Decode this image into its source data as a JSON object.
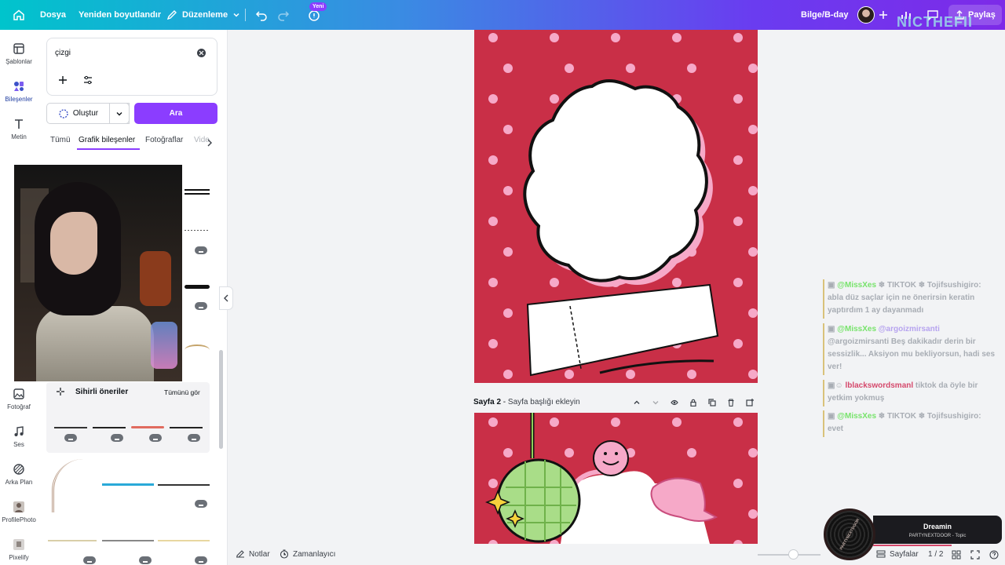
{
  "topbar": {
    "file": "Dosya",
    "resize": "Yeniden boyutlandır",
    "edit": "Düzenleme",
    "new_badge": "Yeni",
    "doc_title": "Bilge/B-day",
    "share": "Paylaş",
    "watermark": "NICTHEFII"
  },
  "rail": [
    {
      "label": "Şablonlar",
      "icon": "templates-icon"
    },
    {
      "label": "Bileşenler",
      "icon": "elements-icon"
    },
    {
      "label": "Metin",
      "icon": "text-icon"
    },
    {
      "label": "Fotoğraf",
      "icon": "photo-icon"
    },
    {
      "label": "Ses",
      "icon": "audio-icon"
    },
    {
      "label": "Arka Plan",
      "icon": "background-icon"
    },
    {
      "label": "ProfilePhoto",
      "icon": "profile-photo-icon"
    },
    {
      "label": "Pixelify",
      "icon": "pixelify-icon"
    }
  ],
  "search": {
    "value": "çizgi",
    "create_label": "Oluştur",
    "search_label": "Ara"
  },
  "tabs": [
    "Tümü",
    "Grafik bileşenler",
    "Fotoğraflar",
    "Vide"
  ],
  "magic": {
    "title": "Sihirli öneriler",
    "see_all": "Tümünü gör"
  },
  "page2": {
    "label": "Sayfa 2",
    "title_placeholder": "Sayfa başlığı ekleyin"
  },
  "chat": [
    {
      "user": "@MissXes",
      "user2": "",
      "text": "❄ TIKTOK ❄ Tojifsushigiro: abla düz saçlar için ne önerirsin keratin yaptırdım 1 ay dayanmadı"
    },
    {
      "user": "@MissXes",
      "user2": "@argoizmirsanti",
      "text": "@argoizmirsanti Beş dakikadır derin bir sessizlik... Aksiyon mu bekliyorsun, hadi ses ver!"
    },
    {
      "user": "lblackswordsmanl",
      "user2": "",
      "text": "tiktok da öyle bir yetkim yokmuş"
    },
    {
      "user": "@MissXes",
      "user2": "",
      "text": "❄ TIKTOK ❄ Tojifsushigiro: evet"
    }
  ],
  "music": {
    "title": "Dreamin",
    "artist": "PARTYNEXTDOOR - Topic",
    "cover_text": "PARTYNEXTDOOR"
  },
  "bottombar": {
    "notes": "Notlar",
    "timer": "Zamanlayıcı",
    "pages": "Sayfalar",
    "page_count": "1 / 2"
  },
  "colors": {
    "accent": "#8b3dff",
    "page_bg": "#c92f47",
    "dot": "#f6a9c8"
  }
}
